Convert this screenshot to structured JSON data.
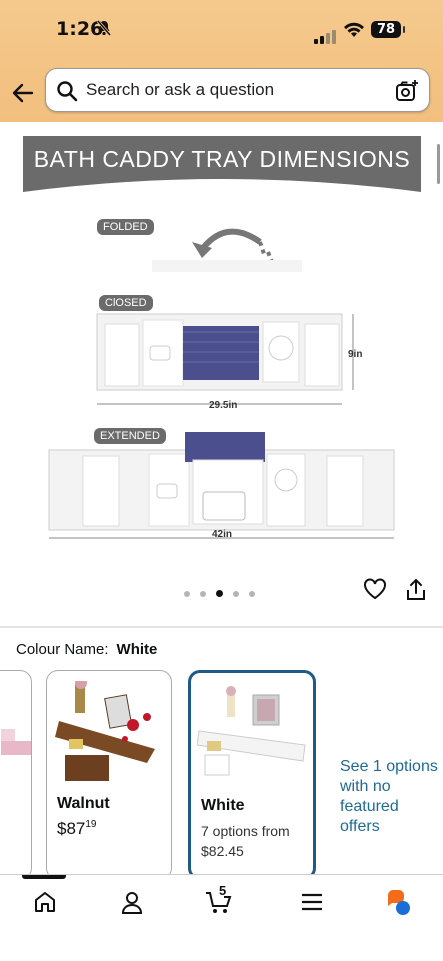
{
  "status": {
    "time": "1:26",
    "battery": "78"
  },
  "search": {
    "placeholder": "Search or ask a question"
  },
  "product_image": {
    "banner_title": "BATH CADDY TRAY DIMENSIONS",
    "labels": {
      "folded": "FOLDED",
      "closed": "ClOSED",
      "extended": "EXTENDED"
    },
    "dimensions": {
      "height": "9in",
      "closed_width": "29.5in",
      "extended_width": "42in"
    },
    "carousel": {
      "count": 5,
      "active_index": 2
    }
  },
  "colour": {
    "label": "Colour Name:",
    "value": "White"
  },
  "swatches": [
    {
      "name": "Walnut",
      "price_whole": "$87",
      "price_fraction": "19"
    },
    {
      "name": "White",
      "options_line1": "7 options from",
      "options_line2": "$82.45"
    }
  ],
  "see_options": "See 1 options with no featured offers",
  "tabbar": {
    "cart_count": "5"
  }
}
